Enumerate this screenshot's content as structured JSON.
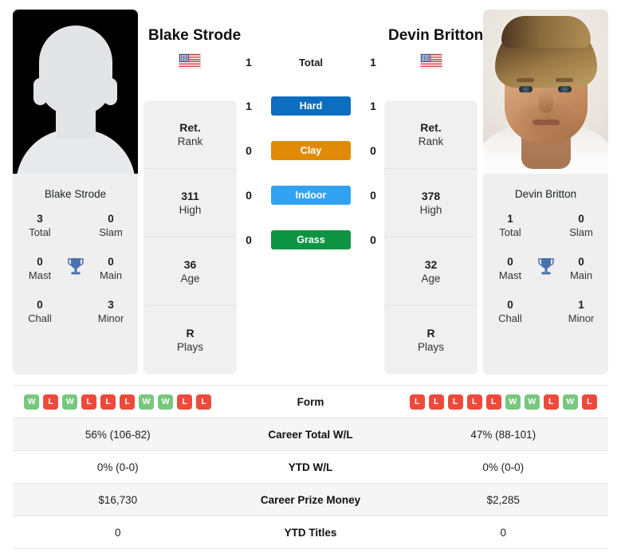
{
  "players": {
    "left": {
      "name": "Blake Strode",
      "card_name": "Blake Strode",
      "country_flag": "us-flag-icon",
      "photo_type": "silhouette-placeholder",
      "titles": {
        "total_val": "3",
        "total_lbl": "Total",
        "slam_val": "0",
        "slam_lbl": "Slam",
        "mast_val": "0",
        "mast_lbl": "Mast",
        "main_val": "0",
        "main_lbl": "Main",
        "chall_val": "0",
        "chall_lbl": "Chall",
        "minor_val": "3",
        "minor_lbl": "Minor"
      },
      "rank": {
        "rank_val": "Ret.",
        "rank_lbl": "Rank",
        "high_val": "311",
        "high_lbl": "High",
        "age_val": "36",
        "age_lbl": "Age",
        "plays_val": "R",
        "plays_lbl": "Plays"
      },
      "surface_wins": {
        "total": "1",
        "hard": "1",
        "clay": "0",
        "indoor": "0",
        "grass": "0"
      },
      "form": [
        "W",
        "L",
        "W",
        "L",
        "L",
        "L",
        "W",
        "W",
        "L",
        "L"
      ],
      "career_total_wl": "56% (106-82)",
      "ytd_wl": "0% (0-0)",
      "career_prize_money": "$16,730",
      "ytd_titles": "0"
    },
    "right": {
      "name": "Devin Britton",
      "card_name": "Devin Britton",
      "country_flag": "us-flag-icon",
      "photo_type": "portrait-photo",
      "titles": {
        "total_val": "1",
        "total_lbl": "Total",
        "slam_val": "0",
        "slam_lbl": "Slam",
        "mast_val": "0",
        "mast_lbl": "Mast",
        "main_val": "0",
        "main_lbl": "Main",
        "chall_val": "0",
        "chall_lbl": "Chall",
        "minor_val": "1",
        "minor_lbl": "Minor"
      },
      "rank": {
        "rank_val": "Ret.",
        "rank_lbl": "Rank",
        "high_val": "378",
        "high_lbl": "High",
        "age_val": "32",
        "age_lbl": "Age",
        "plays_val": "R",
        "plays_lbl": "Plays"
      },
      "surface_wins": {
        "total": "1",
        "hard": "1",
        "clay": "0",
        "indoor": "0",
        "grass": "0"
      },
      "form": [
        "L",
        "L",
        "L",
        "L",
        "L",
        "W",
        "W",
        "L",
        "W",
        "L"
      ],
      "career_total_wl": "47% (88-101)",
      "ytd_wl": "0% (0-0)",
      "career_prize_money": "$2,285",
      "ytd_titles": "0"
    }
  },
  "surfaces": [
    {
      "label": "Total",
      "color": "transparent",
      "text_color": "#1d1d1d"
    },
    {
      "label": "Hard",
      "color": "#0d6ec0",
      "text_color": "#ffffff"
    },
    {
      "label": "Clay",
      "color": "#e08a08",
      "text_color": "#ffffff"
    },
    {
      "label": "Indoor",
      "color": "#31a2f2",
      "text_color": "#ffffff"
    },
    {
      "label": "Grass",
      "color": "#0d9442",
      "text_color": "#ffffff"
    }
  ],
  "stats_labels": {
    "form": "Form",
    "career_total_wl": "Career Total W/L",
    "ytd_wl": "YTD W/L",
    "career_prize_money": "Career Prize Money",
    "ytd_titles": "YTD Titles"
  },
  "colors": {
    "win_badge": "#78c77e",
    "loss_badge": "#ec4b3c",
    "card_bg": "#f0f0f0",
    "row_alt_bg": "#f5f5f5",
    "trophy": "#4a72ad"
  }
}
